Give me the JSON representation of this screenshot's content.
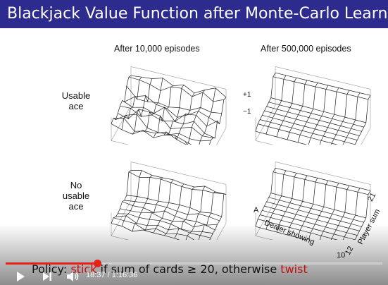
{
  "title": "Blackjack Value Function after Monte-Carlo Learning",
  "columns": [
    "After 10,000 episodes",
    "After 500,000 episodes"
  ],
  "rows": [
    {
      "line1": "Usable",
      "line2": "ace",
      "line3": ""
    },
    {
      "line1": "No",
      "line2": "usable",
      "line3": "ace"
    }
  ],
  "z_ticks": {
    "top": "+1",
    "bottom": "−1"
  },
  "axes": {
    "dealer_tick": "A",
    "dealer_label": "Dealer showing",
    "player_label": "Player sum",
    "player_tick_low": "12",
    "player_tick_high": "21",
    "corner_tick": "10"
  },
  "policy": {
    "prefix": "Policy: ",
    "stick": "stick",
    "middle": " if sum of cards ≥ 20, otherwise ",
    "twist": "twist"
  },
  "video": {
    "time": "18:37 / 1:16:36",
    "progress": 0.243,
    "colors": {
      "progress": "#e62117"
    }
  },
  "colors": {
    "title_bg": "#2e2b8f",
    "highlight": "#c01010"
  }
}
